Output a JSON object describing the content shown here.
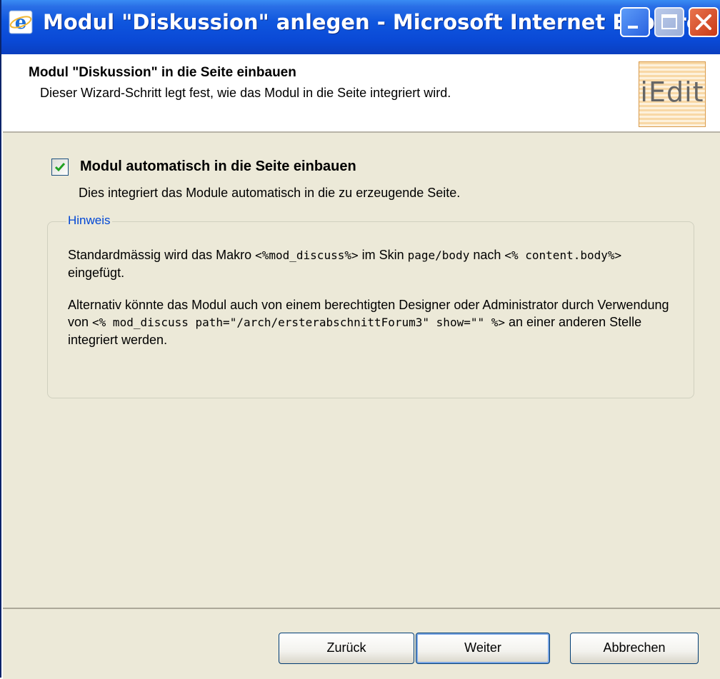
{
  "window": {
    "title": "Modul \"Diskussion\" anlegen - Microsoft Internet Explorer",
    "controls": [
      "minimize-icon",
      "maximize-icon",
      "close-icon"
    ]
  },
  "header": {
    "title": "Modul \"Diskussion\" in die Seite einbauen",
    "subtitle": "Dieser Wizard-Schritt legt fest, wie das Modul in die Seite integriert wird.",
    "logo_text": "iEdit"
  },
  "option": {
    "checked": true,
    "label": "Modul automatisch in die Seite einbauen",
    "description": "Dies integriert das Module automatisch in die zu erzeugende Seite."
  },
  "hint": {
    "legend": "Hinweis",
    "p1": {
      "t1": "Standardmässig wird das Makro ",
      "c1": "<%mod_discuss%>",
      "t2": " im Skin ",
      "c2": "page/body",
      "t3": " nach ",
      "c3": "<% content.body%>",
      "t4": " eingefügt."
    },
    "p2": {
      "t1": "Alternativ könnte das Modul auch von einem berechtigten Designer oder Administrator durch Verwendung von ",
      "c1": "<% mod_discuss path=\"/arch/ersterabschnittForum3\" show=\"\" %>",
      "t2": " an einer anderen Stelle integriert werden."
    }
  },
  "buttons": {
    "back": "Zurück",
    "next": "Weiter",
    "cancel": "Abbrechen"
  },
  "colors": {
    "titlebar": "#0a49d6",
    "dialog_bg": "#ece9d8",
    "legend": "#0046d5"
  }
}
